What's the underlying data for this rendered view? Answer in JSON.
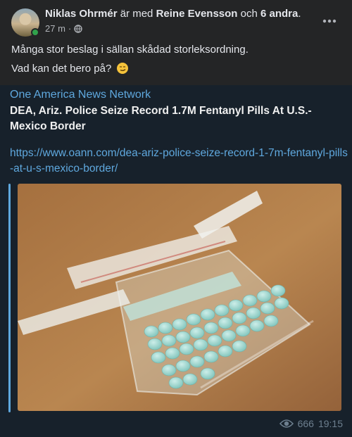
{
  "post": {
    "author": "Niklas Ohrmér",
    "with_word": "är med",
    "tagged": "Reine Evensson",
    "and_word": "och",
    "others": "6 andra",
    "period": ".",
    "time": "27 m",
    "privacy_icon": "globe-icon",
    "more_icon": "more-dots-icon",
    "text_line1": "Många stor beslag i sällan skådad storleksordning.",
    "text_line2": "Vad kan det bero på?",
    "emoji": "smirk-emoji"
  },
  "preview": {
    "site_name": "One America News Network",
    "title": "DEA, Ariz. Police Seize Record 1.7M Fentanyl Pills At U.S.-Mexico Border",
    "link": "https://www.oann.com/dea-ariz-police-seize-record-1-7m-fentanyl-pills-at-u-s-mexico-border/",
    "image": "photo-of-plastic-bag-with-blue-pills"
  },
  "footer": {
    "views_icon": "eye-icon",
    "views": "666",
    "time": "19:15"
  },
  "colors": {
    "facebook_card": "#242526",
    "telegram_bg": "#17212b",
    "link_blue": "#5fa8de",
    "online_green": "#31a24c"
  }
}
